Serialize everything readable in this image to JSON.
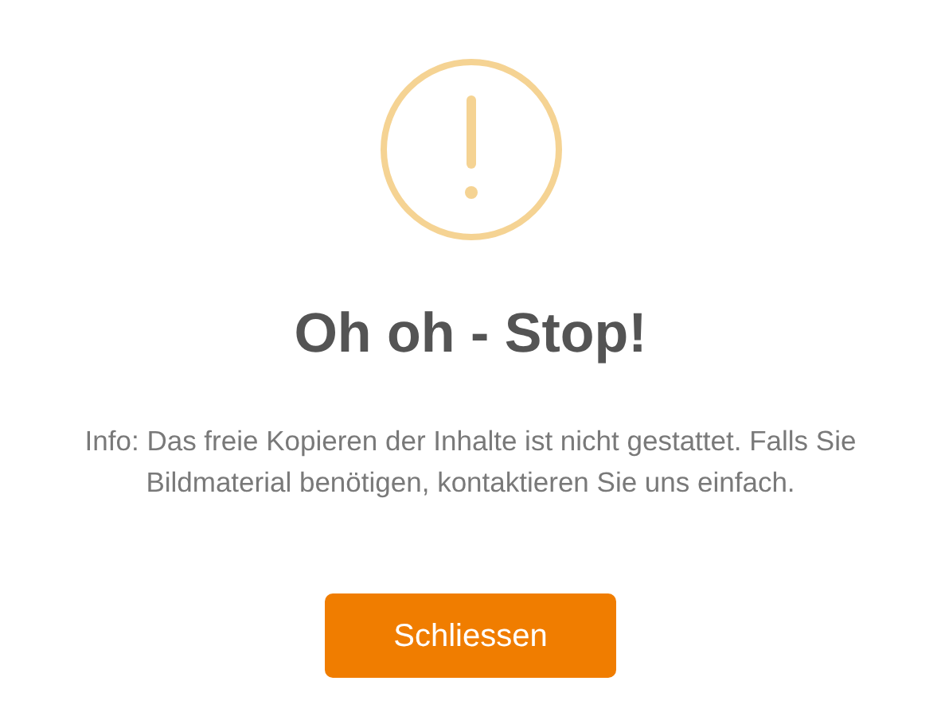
{
  "title": "Oh oh - Stop!",
  "message": "Info: Das freie Kopieren der Inhalte ist nicht gestattet. Falls Sie Bildmaterial benötigen, kontaktieren Sie uns einfach.",
  "button": "Schliessen"
}
